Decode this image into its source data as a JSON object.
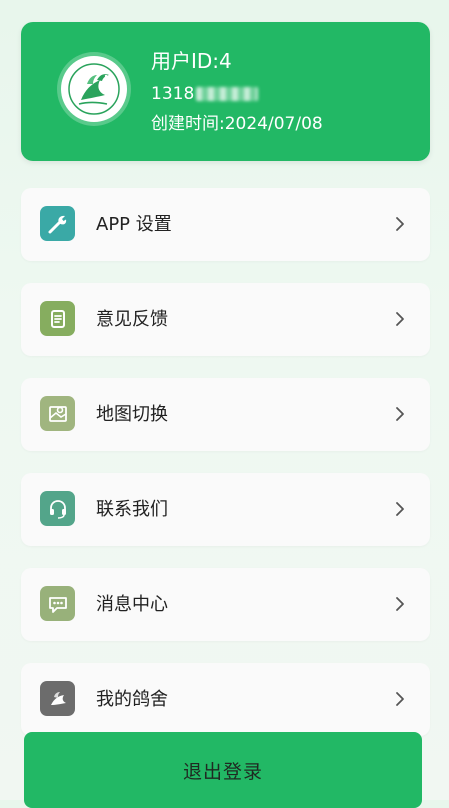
{
  "profile": {
    "user_id": "用户ID:4",
    "phone_prefix": "1318",
    "created_at": "创建时间:2024/07/08"
  },
  "colors": {
    "brand_green": "#22b865",
    "card_bg": "#fafafa",
    "text_dark": "#222222"
  },
  "menu": {
    "items": [
      {
        "label": "APP 设置",
        "icon": "wrench-icon",
        "icon_color": "#3aa9a6"
      },
      {
        "label": "意见反馈",
        "icon": "feedback-document-icon",
        "icon_color": "#86ad5f"
      },
      {
        "label": "地图切换",
        "icon": "map-pin-icon",
        "icon_color": "#a0b57f"
      },
      {
        "label": "联系我们",
        "icon": "headset-icon",
        "icon_color": "#53a58a"
      },
      {
        "label": "消息中心",
        "icon": "chat-bubble-icon",
        "icon_color": "#98b17a"
      },
      {
        "label": "我的鸽舍",
        "icon": "pigeon-icon",
        "icon_color": "#6c6c6c"
      }
    ]
  },
  "logout": {
    "label": "退出登录"
  }
}
